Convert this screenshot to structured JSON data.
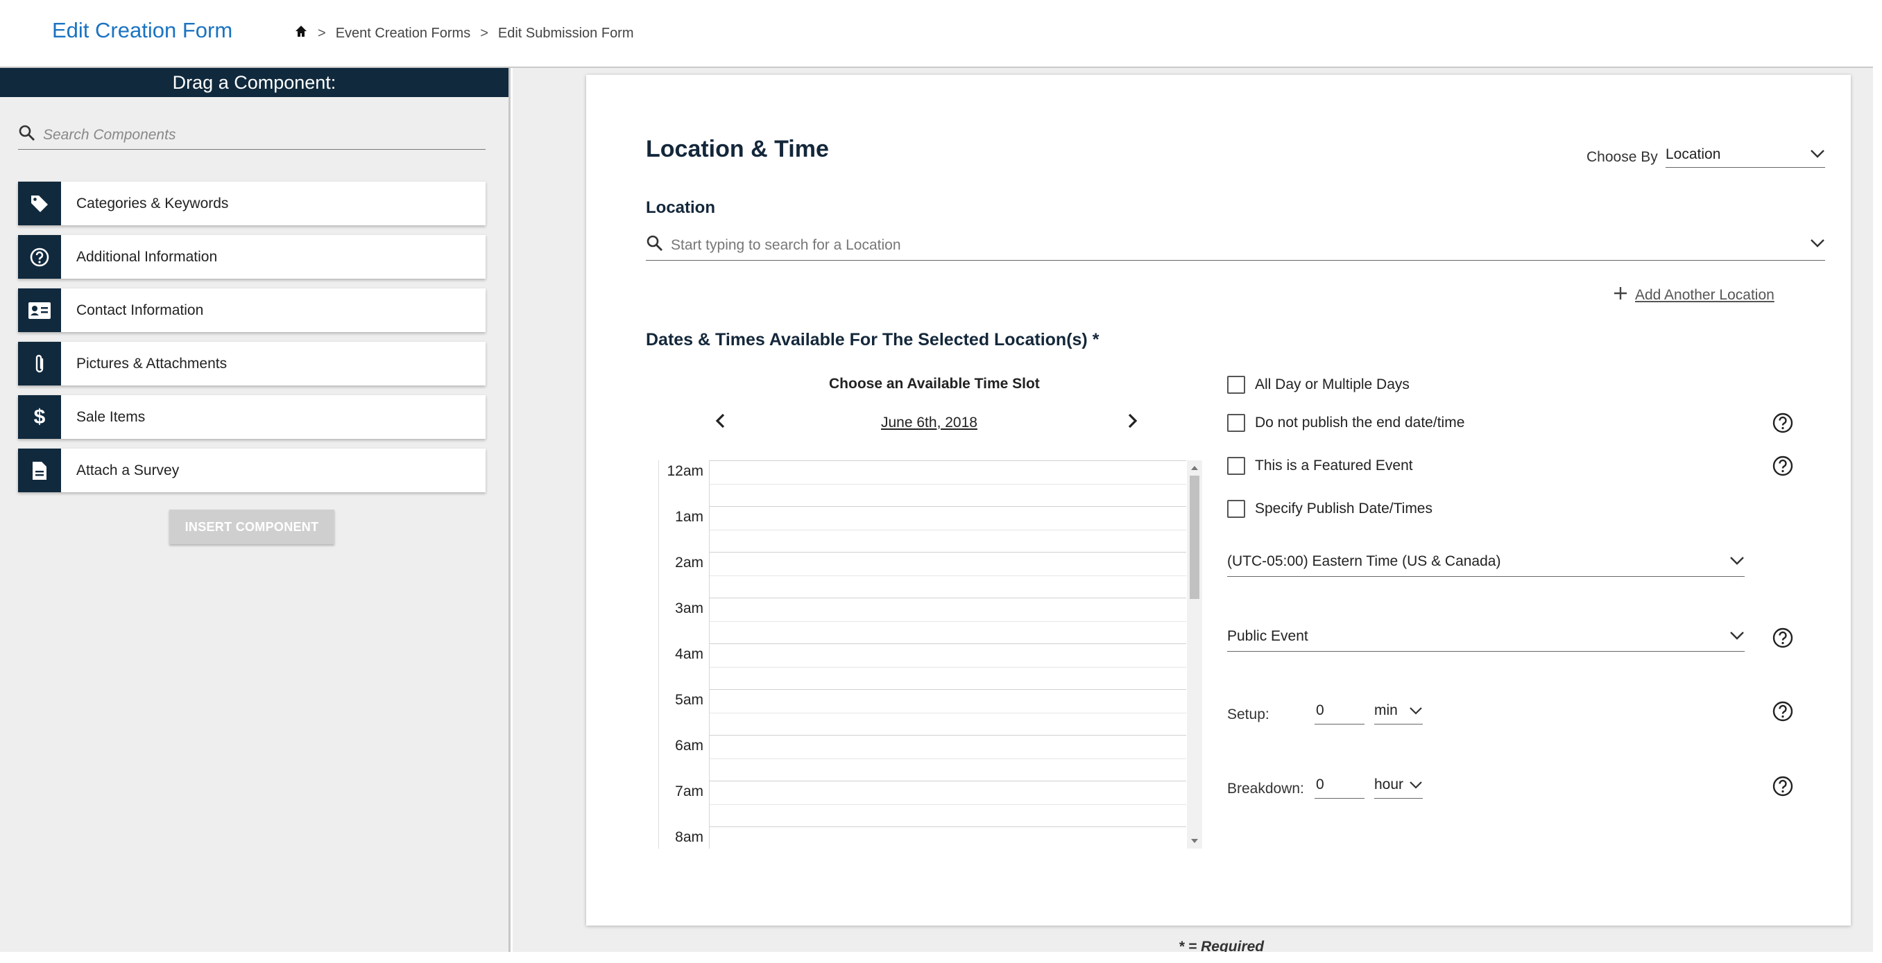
{
  "header": {
    "title": "Edit Creation Form",
    "breadcrumb": [
      "Event Creation Forms",
      "Edit Submission Form"
    ],
    "breadcrumb_sep": ">"
  },
  "sidebar": {
    "heading": "Drag a Component:",
    "search_placeholder": "Search Components",
    "components": [
      {
        "label": "Categories & Keywords",
        "icon": "tag-icon"
      },
      {
        "label": "Additional Information",
        "icon": "question-circle-icon"
      },
      {
        "label": "Contact Information",
        "icon": "contact-card-icon"
      },
      {
        "label": "Pictures & Attachments",
        "icon": "paperclip-icon"
      },
      {
        "label": "Sale Items",
        "icon": "dollar-icon"
      },
      {
        "label": "Attach a Survey",
        "icon": "document-icon"
      }
    ],
    "insert_label": "INSERT COMPONENT"
  },
  "main": {
    "section_title": "Location & Time",
    "choose_by_label": "Choose By",
    "choose_by_value": "Location",
    "location_label": "Location",
    "location_placeholder": "Start typing to search for a Location",
    "add_location": "Add Another Location",
    "dates_title": "Dates & Times Available For The Selected Location(s) *",
    "calendar": {
      "title": "Choose an Available Time Slot",
      "date": "June 6th, 2018",
      "hours": [
        "12am",
        "1am",
        "2am",
        "3am",
        "4am",
        "5am",
        "6am",
        "7am",
        "8am"
      ]
    },
    "options": {
      "all_day": "All Day or Multiple Days",
      "no_end": "Do not publish the end date/time",
      "featured": "This is a Featured Event",
      "publish_dates": "Specify Publish Date/Times"
    },
    "timezone": "(UTC-05:00) Eastern Time (US & Canada)",
    "event_type": "Public Event",
    "setup": {
      "label": "Setup:",
      "value": "0",
      "unit": "min"
    },
    "breakdown": {
      "label": "Breakdown:",
      "value": "0",
      "unit": "hour"
    },
    "required_note": "* = Required"
  },
  "colors": {
    "accent": "#1a73c2",
    "navy": "#10293d",
    "panel_bg": "#eeeeee"
  }
}
